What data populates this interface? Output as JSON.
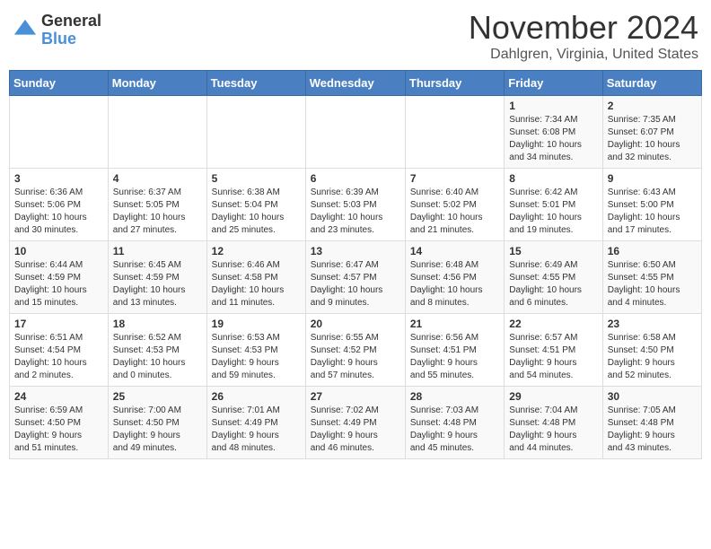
{
  "header": {
    "logo_general": "General",
    "logo_blue": "Blue",
    "month": "November 2024",
    "location": "Dahlgren, Virginia, United States"
  },
  "days_of_week": [
    "Sunday",
    "Monday",
    "Tuesday",
    "Wednesday",
    "Thursday",
    "Friday",
    "Saturday"
  ],
  "weeks": [
    [
      {
        "day": "",
        "content": ""
      },
      {
        "day": "",
        "content": ""
      },
      {
        "day": "",
        "content": ""
      },
      {
        "day": "",
        "content": ""
      },
      {
        "day": "",
        "content": ""
      },
      {
        "day": "1",
        "content": "Sunrise: 7:34 AM\nSunset: 6:08 PM\nDaylight: 10 hours\nand 34 minutes."
      },
      {
        "day": "2",
        "content": "Sunrise: 7:35 AM\nSunset: 6:07 PM\nDaylight: 10 hours\nand 32 minutes."
      }
    ],
    [
      {
        "day": "3",
        "content": "Sunrise: 6:36 AM\nSunset: 5:06 PM\nDaylight: 10 hours\nand 30 minutes."
      },
      {
        "day": "4",
        "content": "Sunrise: 6:37 AM\nSunset: 5:05 PM\nDaylight: 10 hours\nand 27 minutes."
      },
      {
        "day": "5",
        "content": "Sunrise: 6:38 AM\nSunset: 5:04 PM\nDaylight: 10 hours\nand 25 minutes."
      },
      {
        "day": "6",
        "content": "Sunrise: 6:39 AM\nSunset: 5:03 PM\nDaylight: 10 hours\nand 23 minutes."
      },
      {
        "day": "7",
        "content": "Sunrise: 6:40 AM\nSunset: 5:02 PM\nDaylight: 10 hours\nand 21 minutes."
      },
      {
        "day": "8",
        "content": "Sunrise: 6:42 AM\nSunset: 5:01 PM\nDaylight: 10 hours\nand 19 minutes."
      },
      {
        "day": "9",
        "content": "Sunrise: 6:43 AM\nSunset: 5:00 PM\nDaylight: 10 hours\nand 17 minutes."
      }
    ],
    [
      {
        "day": "10",
        "content": "Sunrise: 6:44 AM\nSunset: 4:59 PM\nDaylight: 10 hours\nand 15 minutes."
      },
      {
        "day": "11",
        "content": "Sunrise: 6:45 AM\nSunset: 4:59 PM\nDaylight: 10 hours\nand 13 minutes."
      },
      {
        "day": "12",
        "content": "Sunrise: 6:46 AM\nSunset: 4:58 PM\nDaylight: 10 hours\nand 11 minutes."
      },
      {
        "day": "13",
        "content": "Sunrise: 6:47 AM\nSunset: 4:57 PM\nDaylight: 10 hours\nand 9 minutes."
      },
      {
        "day": "14",
        "content": "Sunrise: 6:48 AM\nSunset: 4:56 PM\nDaylight: 10 hours\nand 8 minutes."
      },
      {
        "day": "15",
        "content": "Sunrise: 6:49 AM\nSunset: 4:55 PM\nDaylight: 10 hours\nand 6 minutes."
      },
      {
        "day": "16",
        "content": "Sunrise: 6:50 AM\nSunset: 4:55 PM\nDaylight: 10 hours\nand 4 minutes."
      }
    ],
    [
      {
        "day": "17",
        "content": "Sunrise: 6:51 AM\nSunset: 4:54 PM\nDaylight: 10 hours\nand 2 minutes."
      },
      {
        "day": "18",
        "content": "Sunrise: 6:52 AM\nSunset: 4:53 PM\nDaylight: 10 hours\nand 0 minutes."
      },
      {
        "day": "19",
        "content": "Sunrise: 6:53 AM\nSunset: 4:53 PM\nDaylight: 9 hours\nand 59 minutes."
      },
      {
        "day": "20",
        "content": "Sunrise: 6:55 AM\nSunset: 4:52 PM\nDaylight: 9 hours\nand 57 minutes."
      },
      {
        "day": "21",
        "content": "Sunrise: 6:56 AM\nSunset: 4:51 PM\nDaylight: 9 hours\nand 55 minutes."
      },
      {
        "day": "22",
        "content": "Sunrise: 6:57 AM\nSunset: 4:51 PM\nDaylight: 9 hours\nand 54 minutes."
      },
      {
        "day": "23",
        "content": "Sunrise: 6:58 AM\nSunset: 4:50 PM\nDaylight: 9 hours\nand 52 minutes."
      }
    ],
    [
      {
        "day": "24",
        "content": "Sunrise: 6:59 AM\nSunset: 4:50 PM\nDaylight: 9 hours\nand 51 minutes."
      },
      {
        "day": "25",
        "content": "Sunrise: 7:00 AM\nSunset: 4:50 PM\nDaylight: 9 hours\nand 49 minutes."
      },
      {
        "day": "26",
        "content": "Sunrise: 7:01 AM\nSunset: 4:49 PM\nDaylight: 9 hours\nand 48 minutes."
      },
      {
        "day": "27",
        "content": "Sunrise: 7:02 AM\nSunset: 4:49 PM\nDaylight: 9 hours\nand 46 minutes."
      },
      {
        "day": "28",
        "content": "Sunrise: 7:03 AM\nSunset: 4:48 PM\nDaylight: 9 hours\nand 45 minutes."
      },
      {
        "day": "29",
        "content": "Sunrise: 7:04 AM\nSunset: 4:48 PM\nDaylight: 9 hours\nand 44 minutes."
      },
      {
        "day": "30",
        "content": "Sunrise: 7:05 AM\nSunset: 4:48 PM\nDaylight: 9 hours\nand 43 minutes."
      }
    ]
  ]
}
